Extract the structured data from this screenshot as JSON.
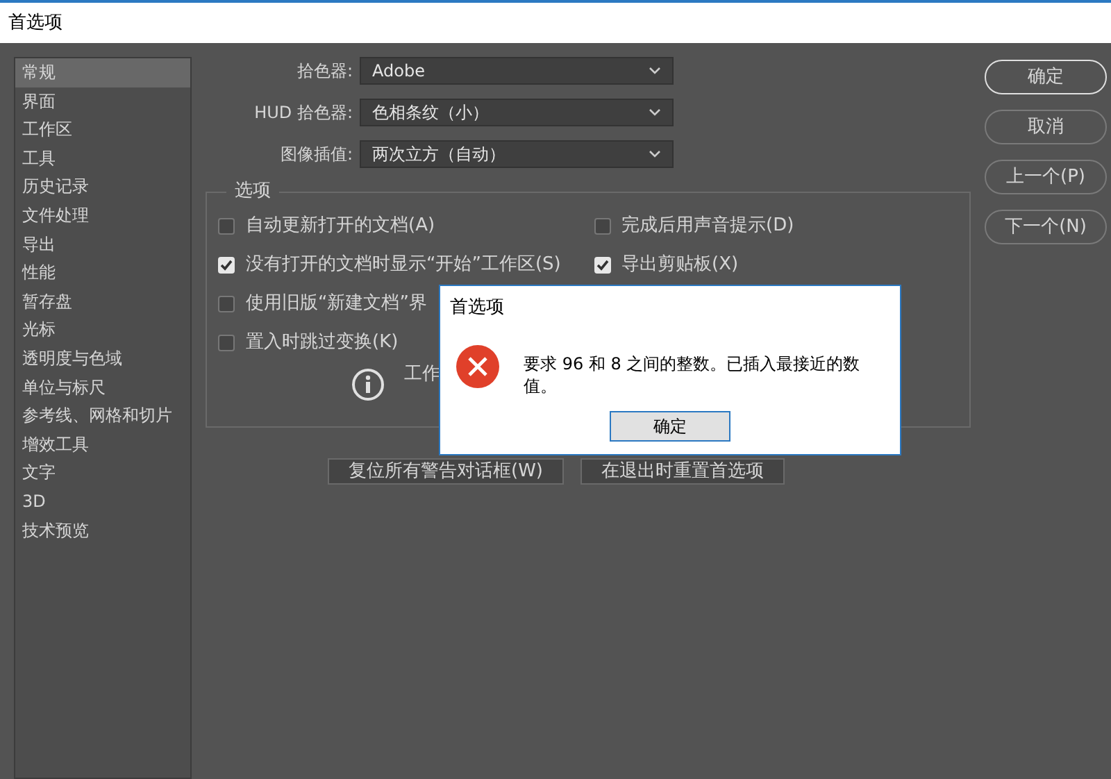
{
  "window": {
    "title": "首选项"
  },
  "sidebar": {
    "items": [
      {
        "label": "常规",
        "selected": true
      },
      {
        "label": "界面",
        "selected": false
      },
      {
        "label": "工作区",
        "selected": false
      },
      {
        "label": "工具",
        "selected": false
      },
      {
        "label": "历史记录",
        "selected": false
      },
      {
        "label": "文件处理",
        "selected": false
      },
      {
        "label": "导出",
        "selected": false
      },
      {
        "label": "性能",
        "selected": false
      },
      {
        "label": "暂存盘",
        "selected": false
      },
      {
        "label": "光标",
        "selected": false
      },
      {
        "label": "透明度与色域",
        "selected": false
      },
      {
        "label": "单位与标尺",
        "selected": false
      },
      {
        "label": "参考线、网格和切片",
        "selected": false
      },
      {
        "label": "增效工具",
        "selected": false
      },
      {
        "label": "文字",
        "selected": false
      },
      {
        "label": "3D",
        "selected": false
      },
      {
        "label": "技术预览",
        "selected": false
      }
    ]
  },
  "fields": [
    {
      "label": "拾色器:",
      "value": "Adobe"
    },
    {
      "label": "HUD 拾色器:",
      "value": "色相条纹（小）"
    },
    {
      "label": "图像插值:",
      "value": "两次立方（自动）"
    }
  ],
  "options": {
    "title": "选项",
    "rows": [
      [
        {
          "label": "自动更新打开的文档(A)",
          "checked": false
        },
        {
          "label": "完成后用声音提示(D)",
          "checked": false
        }
      ],
      [
        {
          "label": "没有打开的文档时显示“开始”工作区(S)",
          "checked": true
        },
        {
          "label": "导出剪贴板(X)",
          "checked": true
        }
      ],
      [
        {
          "label": "使用旧版“新建文档”界",
          "checked": false
        }
      ],
      [
        {
          "label": "置入时跳过变换(K)",
          "checked": false
        }
      ]
    ],
    "info_text": "工作"
  },
  "bottom_buttons": [
    "复位所有警告对话框(W)",
    "在退出时重置首选项"
  ],
  "side_buttons": [
    {
      "label": "确定",
      "default": true
    },
    {
      "label": "取消",
      "default": false
    },
    {
      "label": "上一个(P)",
      "default": false
    },
    {
      "label": "下一个(N)",
      "default": false
    }
  ],
  "alert": {
    "title": "首选项",
    "message": "要求 96 和 8 之间的整数。已插入最接近的数值。",
    "button": "确定"
  }
}
